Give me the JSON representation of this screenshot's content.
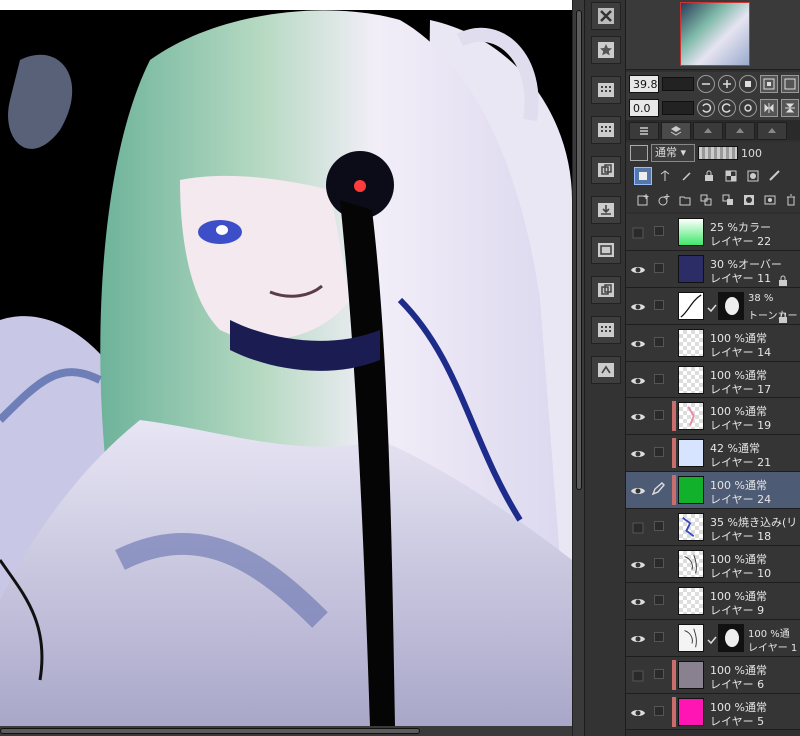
{
  "navigator": {
    "zoom": "39.8",
    "rotation": "0.0"
  },
  "layer_properties": {
    "blend_mode": "通常",
    "opacity": "100"
  },
  "layers": [
    {
      "opacity": "25 %",
      "mode": "カラー",
      "name": "レイヤー 22",
      "visible": false,
      "thumb": "gradient-green",
      "locked": false,
      "clipped": false
    },
    {
      "opacity": "30 %",
      "mode": "オーバー",
      "name": "レイヤー 11",
      "visible": true,
      "thumb": "navy",
      "locked": true,
      "clipped": false
    },
    {
      "opacity": "38 %",
      "mode": "",
      "name": "トーンカーブ",
      "visible": true,
      "thumb": "tone-curve",
      "locked": true,
      "clipped": false,
      "mask": true
    },
    {
      "opacity": "100 %",
      "mode": "通常",
      "name": "レイヤー 14",
      "visible": true,
      "thumb": "checker",
      "locked": false,
      "clipped": false
    },
    {
      "opacity": "100 %",
      "mode": "通常",
      "name": "レイヤー 17",
      "visible": true,
      "thumb": "checker",
      "locked": false,
      "clipped": false
    },
    {
      "opacity": "100 %",
      "mode": "通常",
      "name": "レイヤー 19",
      "visible": true,
      "thumb": "checker-pink",
      "locked": false,
      "clipped": true
    },
    {
      "opacity": "42 %",
      "mode": "通常",
      "name": "レイヤー 21",
      "visible": true,
      "thumb": "lightblue",
      "locked": false,
      "clipped": true
    },
    {
      "opacity": "100 %",
      "mode": "通常",
      "name": "レイヤー 24",
      "visible": true,
      "thumb": "green",
      "locked": false,
      "clipped": true,
      "selected": true
    },
    {
      "opacity": "35 %",
      "mode": "焼き込み(リニ",
      "name": "レイヤー 18",
      "visible": false,
      "thumb": "checker-blue",
      "locked": false,
      "clipped": false
    },
    {
      "opacity": "100 %",
      "mode": "通常",
      "name": "レイヤー 10",
      "visible": true,
      "thumb": "checker-sketch",
      "locked": false,
      "clipped": false
    },
    {
      "opacity": "100 %",
      "mode": "通常",
      "name": "レイヤー 9",
      "visible": true,
      "thumb": "checker",
      "locked": false,
      "clipped": false
    },
    {
      "opacity": "100 %",
      "mode": "通",
      "name": "レイヤー 1",
      "visible": true,
      "thumb": "sketch",
      "locked": false,
      "clipped": false,
      "mask": true
    },
    {
      "opacity": "100 %",
      "mode": "通常",
      "name": "レイヤー 6",
      "visible": false,
      "thumb": "gray",
      "locked": false,
      "clipped": true
    },
    {
      "opacity": "100 %",
      "mode": "通常",
      "name": "レイヤー 5",
      "visible": true,
      "thumb": "magenta",
      "locked": false,
      "clipped": true
    }
  ],
  "thumb_colors": {
    "navy": "#2c2c66",
    "lightblue": "#d6e4ff",
    "green": "#12b12c",
    "gray": "#8a8190",
    "magenta": "#ff14b4"
  },
  "icons": {
    "tool_strip": [
      "close-icon",
      "favorite-icon",
      "palette-icon",
      "palette-icon",
      "folder-layer-icon",
      "import-icon",
      "material-icon",
      "folder-layer-icon",
      "palette-icon",
      "history-icon"
    ]
  }
}
